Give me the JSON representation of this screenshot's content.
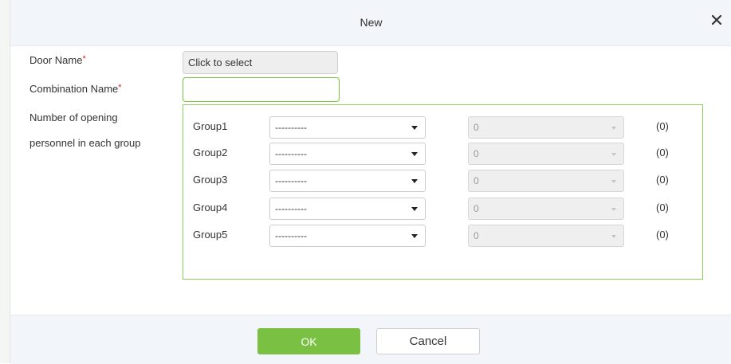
{
  "dialog": {
    "title": "New",
    "close_icon": "close-icon"
  },
  "form": {
    "door_name_label": "Door Name",
    "combination_name_label": "Combination Name",
    "required_mark": "*",
    "door_select_value": "Click to select",
    "combination_name_value": "",
    "opening_personnel_label_line1": "Number of opening",
    "opening_personnel_label_line2": "personnel in each group"
  },
  "groups": [
    {
      "label": "Group1",
      "group_value": "----------",
      "count_value": "0",
      "total": "(0)"
    },
    {
      "label": "Group2",
      "group_value": "----------",
      "count_value": "0",
      "total": "(0)"
    },
    {
      "label": "Group3",
      "group_value": "----------",
      "count_value": "0",
      "total": "(0)"
    },
    {
      "label": "Group4",
      "group_value": "----------",
      "count_value": "0",
      "total": "(0)"
    },
    {
      "label": "Group5",
      "group_value": "----------",
      "count_value": "0",
      "total": "(0)"
    }
  ],
  "footer": {
    "ok_label": "OK",
    "cancel_label": "Cancel"
  },
  "colors": {
    "accent": "#7ac143",
    "required": "#e02020",
    "header_bg": "#f2f5fa"
  }
}
